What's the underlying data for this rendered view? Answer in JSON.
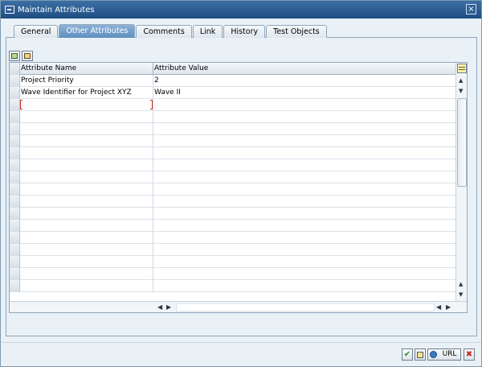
{
  "window": {
    "title": "Maintain Attributes",
    "close_glyph": "×"
  },
  "tabs": [
    {
      "label": "General",
      "active": false
    },
    {
      "label": "Other Attributes",
      "active": true
    },
    {
      "label": "Comments",
      "active": false
    },
    {
      "label": "Link",
      "active": false
    },
    {
      "label": "History",
      "active": false
    },
    {
      "label": "Test Objects",
      "active": false
    }
  ],
  "toolbar": {
    "insert_icon": "insert-row-icon",
    "delete_icon": "delete-row-icon"
  },
  "table": {
    "columns": [
      "Attribute Name",
      "Attribute Value"
    ],
    "rows": [
      [
        "Project Priority",
        "2"
      ],
      [
        "Wave Identifier for Project XYZ",
        "Wave II"
      ],
      [
        "",
        ""
      ],
      [
        "",
        ""
      ],
      [
        "",
        ""
      ],
      [
        "",
        ""
      ],
      [
        "",
        ""
      ],
      [
        "",
        ""
      ],
      [
        "",
        ""
      ],
      [
        "",
        ""
      ],
      [
        "",
        ""
      ],
      [
        "",
        ""
      ],
      [
        "",
        ""
      ],
      [
        "",
        ""
      ],
      [
        "",
        ""
      ],
      [
        "",
        ""
      ],
      [
        "",
        ""
      ],
      [
        "",
        ""
      ]
    ]
  },
  "scroll": {
    "up": "▲",
    "down": "▼",
    "left": "◀",
    "right": "▶"
  },
  "footer": {
    "url_label": "URL",
    "confirm_glyph": "✔",
    "cancel_glyph": "✖"
  }
}
